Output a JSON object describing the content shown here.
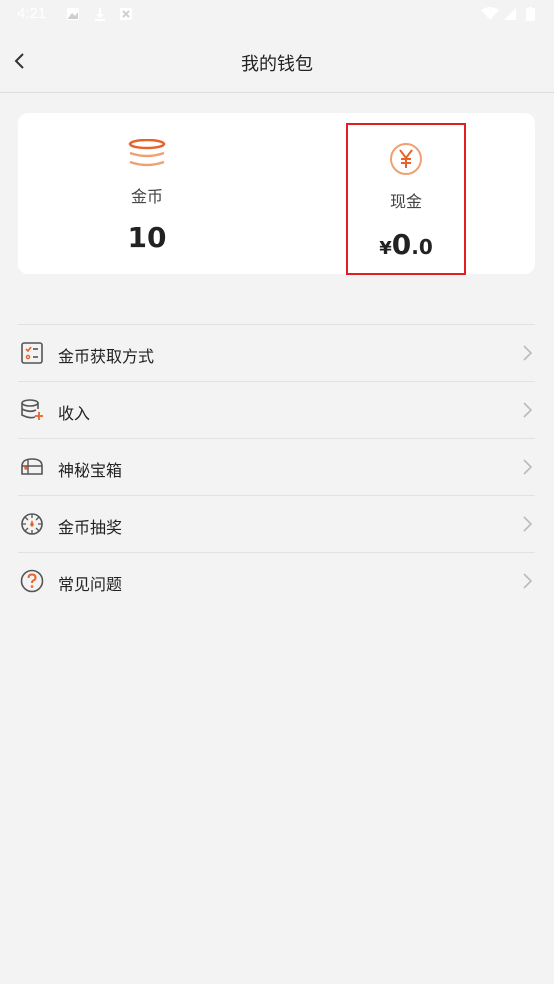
{
  "status_bar": {
    "time": "4:21"
  },
  "app_bar": {
    "title": "我的钱包"
  },
  "wallet": {
    "coins": {
      "label": "金币",
      "value": "10"
    },
    "cash": {
      "label": "现金",
      "currency": "¥",
      "integer": "0",
      "decimal": ".0"
    }
  },
  "menu": {
    "items": [
      {
        "label": "金币获取方式",
        "icon": "task-list-icon"
      },
      {
        "label": "收入",
        "icon": "coin-stack-plus-icon"
      },
      {
        "label": "神秘宝箱",
        "icon": "treasure-chest-icon"
      },
      {
        "label": "金币抽奖",
        "icon": "lottery-wheel-icon"
      },
      {
        "label": "常见问题",
        "icon": "question-circle-icon"
      }
    ]
  },
  "colors": {
    "accent": "#e8632a",
    "highlight_border": "#e02020",
    "background": "#f3f3f3"
  }
}
